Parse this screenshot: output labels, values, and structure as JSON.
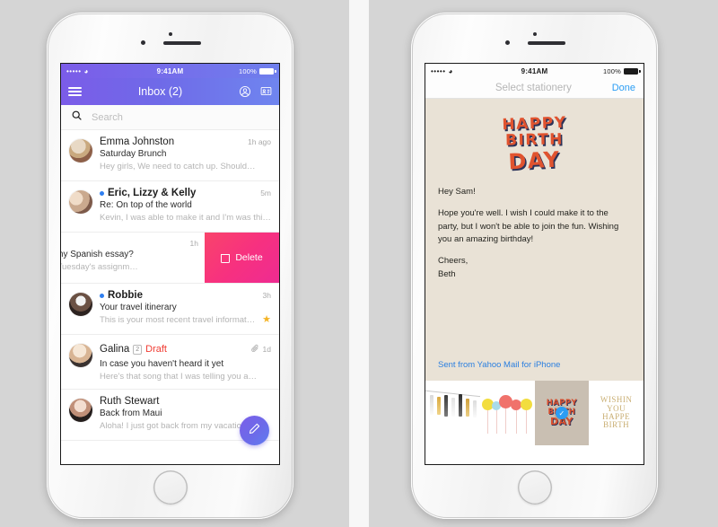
{
  "left_phone": {
    "status_bar": {
      "signal": "•••••",
      "wifi": "wifi-icon",
      "time": "9:41AM",
      "battery": "100%"
    },
    "navbar": {
      "menu_icon": "hamburger-menu-icon",
      "title": "Inbox (2)",
      "profile_icon": "person-circle-icon",
      "contacts_icon": "contact-card-icon"
    },
    "search": {
      "icon": "search-icon",
      "placeholder": "Search"
    },
    "mail_rows": [
      {
        "sender": "Emma Johnston",
        "subject": "Saturday Brunch",
        "preview": "Hey girls, We need to catch up. Should…",
        "time": "1h ago",
        "unread": false,
        "starred": false
      },
      {
        "sender": "Eric, Lizzy & Kelly",
        "subject": "Re: On top of the world",
        "preview": "Kevin, I was able to make it and I'm was thin…",
        "time": "5m",
        "unread": true,
        "starred": false
      },
      {
        "sender": "",
        "subject": "lp with my Spanish essay?",
        "preview": "ne with Tuesday's assignm…",
        "time": "1h",
        "swiped": true,
        "delete_label": "Delete",
        "delete_icon": "trash-icon"
      },
      {
        "sender": "Robbie",
        "subject": "Your travel itinerary",
        "preview": "This is your most recent travel informati…",
        "time": "3h",
        "unread": true,
        "starred": true,
        "star_icon": "star-icon"
      },
      {
        "sender": "Galina",
        "badge_count": "2",
        "draft_label": "Draft",
        "subject": "In case you haven't heard it yet",
        "preview": "Here's that song that I was telling you a…",
        "time": "1d",
        "attachment_icon": "paperclip-icon",
        "unread": false,
        "starred": false
      },
      {
        "sender": "Ruth Stewart",
        "subject": "Back from Maui",
        "preview": "Aloha! I just got back from my vacation…",
        "time": "",
        "unread": false,
        "starred": false
      }
    ],
    "compose_button": {
      "icon": "compose-pencil-icon"
    }
  },
  "right_phone": {
    "status_bar": {
      "signal": "•••••",
      "wifi": "wifi-icon",
      "time": "9:41AM",
      "battery": "100%"
    },
    "topbar": {
      "title": "Select stationery",
      "done_label": "Done"
    },
    "stationery_art": {
      "line1": "HAPPY",
      "line2": "BIRTH",
      "line3": "DAY"
    },
    "message": {
      "greeting": "Hey Sam!",
      "paragraph": "Hope you're well. I wish I could make it to the party, but I won't be able to join the fun. Wishing you an amazing birthday!",
      "closing": "Cheers,",
      "name": "Beth",
      "signature": "Sent from Yahoo Mail for iPhone"
    },
    "thumbnails": [
      {
        "name": "tassel-garland",
        "selected": false
      },
      {
        "name": "balloons",
        "selected": false
      },
      {
        "name": "happy-birthday",
        "selected": true,
        "check_icon": "check-icon",
        "l1": "HAPPY",
        "l2": "BIRTH",
        "l3": "DAY"
      },
      {
        "name": "gold-wishing",
        "selected": false,
        "l1": "WISHIN",
        "l2": "YOU",
        "l3": "HAPPE",
        "l4": "BIRTH"
      }
    ]
  },
  "colors": {
    "navbar_start": "#7b5ce8",
    "navbar_end": "#6f85ef",
    "delete_gradient_start": "#f9446b",
    "delete_gradient_end": "#ee2b92",
    "draft_red": "#f03b32",
    "link_blue": "#2b9df4",
    "star_gold": "#f4b324",
    "letter_bg": "#e9e2d6"
  }
}
